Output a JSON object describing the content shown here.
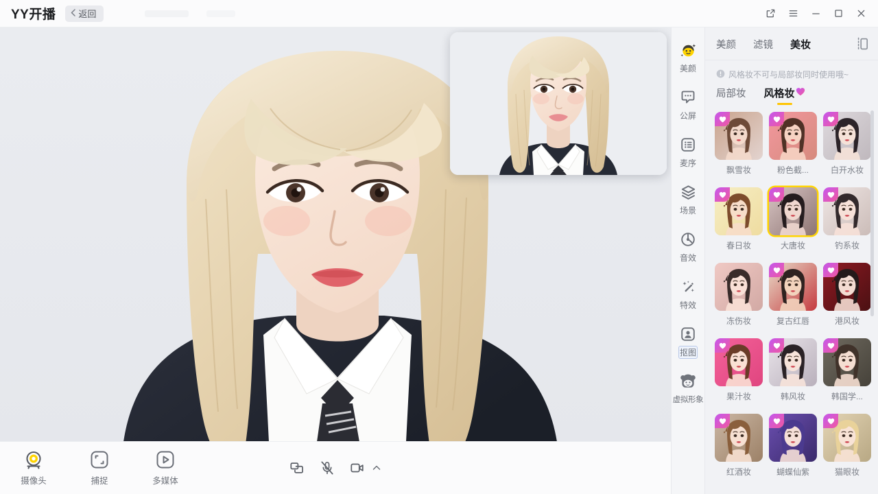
{
  "titlebar": {
    "brand": "YY开播",
    "back_label": "返回",
    "back_icon": "chevron-left-icon",
    "window_controls": [
      {
        "name": "external-link-icon",
        "label": "弹出"
      },
      {
        "name": "menu-icon",
        "label": "菜单"
      },
      {
        "name": "minimize-icon",
        "label": "最小化"
      },
      {
        "name": "maximize-icon",
        "label": "最大化"
      },
      {
        "name": "close-icon",
        "label": "关闭"
      }
    ]
  },
  "stage": {
    "canvas_bg": "#e8eaee",
    "pip": {
      "name": "preview-window",
      "visible": true
    }
  },
  "bottombar": {
    "tools": [
      {
        "icon": "webcam-icon",
        "label": "摄像头",
        "active": true
      },
      {
        "icon": "capture-icon",
        "label": "捕捉",
        "active": false
      },
      {
        "icon": "multimedia-icon",
        "label": "多媒体",
        "active": false
      }
    ],
    "mid_controls": [
      {
        "icon": "screen-share-icon",
        "label": "共享屏幕",
        "state": "on"
      },
      {
        "icon": "microphone-muted-icon",
        "label": "麦克风已静音",
        "state": "muted"
      },
      {
        "icon": "camera-icon",
        "label": "摄像头",
        "state": "on"
      },
      {
        "icon": "chevron-up-icon",
        "label": "更多设备",
        "state": "collapsed"
      }
    ]
  },
  "rail": {
    "items": [
      {
        "icon": "beauty-face-icon",
        "label": "美颜",
        "active": true
      },
      {
        "icon": "public-screen-icon",
        "label": "公屏",
        "active": false
      },
      {
        "icon": "mic-queue-icon",
        "label": "麦序",
        "active": false
      },
      {
        "icon": "scene-layers-icon",
        "label": "场景",
        "active": false
      },
      {
        "icon": "sound-effect-icon",
        "label": "音效",
        "active": false
      },
      {
        "icon": "special-effect-icon",
        "label": "特效",
        "active": false
      },
      {
        "icon": "cutout-icon",
        "label": "抠图",
        "active": false,
        "label_boxed": true
      },
      {
        "icon": "virtual-avatar-icon",
        "label": "虚拟形象",
        "active": false
      }
    ]
  },
  "panel": {
    "tabs": [
      {
        "label": "美颜",
        "active": false
      },
      {
        "label": "滤镜",
        "active": false
      },
      {
        "label": "美妆",
        "active": true
      }
    ],
    "collapse_icon": "collapse-panel-icon",
    "notice": "风格妆不可与局部妆同时使用哦~",
    "notice_icon": "warning-circle-icon",
    "subtabs": [
      {
        "label": "局部妆",
        "active": false,
        "badge": false
      },
      {
        "label": "风格妆",
        "active": true,
        "badge": true,
        "badge_icon": "heart-badge-icon"
      }
    ],
    "accent_color": "#ffc400",
    "selected_style": "大唐妆",
    "styles": [
      {
        "label": "飘雪妆",
        "selected": false,
        "favorite": true,
        "c1": "#c9a38c",
        "c2": "#e3d4d0",
        "hair": "#6d4a38",
        "skin": "#f3d9cb"
      },
      {
        "label": "粉色截...",
        "selected": false,
        "favorite": true,
        "c1": "#f3989f",
        "c2": "#d68a7d",
        "hair": "#4f3126",
        "skin": "#f6d3c3"
      },
      {
        "label": "白开水妆",
        "selected": false,
        "favorite": true,
        "c1": "#ded9dd",
        "c2": "#bfb8bd",
        "hair": "#2c2429",
        "skin": "#f5e2d8"
      },
      {
        "label": "春日妆",
        "selected": false,
        "favorite": true,
        "c1": "#f6eec4",
        "c2": "#efdca0",
        "hair": "#7d4c2c",
        "skin": "#f7ddc9"
      },
      {
        "label": "大唐妆",
        "selected": true,
        "favorite": true,
        "c1": "#d8c5c4",
        "c2": "#8d7472",
        "hair": "#251c1e",
        "skin": "#f0d7cf"
      },
      {
        "label": "钓系妆",
        "selected": false,
        "favorite": true,
        "c1": "#efe6e4",
        "c2": "#cbbcb8",
        "hair": "#332a2c",
        "skin": "#f7e1d8"
      },
      {
        "label": "冻伤妆",
        "selected": false,
        "favorite": false,
        "c1": "#f0c9c4",
        "c2": "#d2a9a4",
        "hair": "#3a2c2a",
        "skin": "#f9e0d6"
      },
      {
        "label": "复古红唇",
        "selected": false,
        "favorite": true,
        "c1": "#e8dcc9",
        "c2": "#c53a3f",
        "hair": "#2e2220",
        "skin": "#f2d3bd"
      },
      {
        "label": "港风妆",
        "selected": false,
        "favorite": true,
        "c1": "#8e1a22",
        "c2": "#4b1013",
        "hair": "#241a1a",
        "skin": "#f4dcd2"
      },
      {
        "label": "果汁妆",
        "selected": false,
        "favorite": true,
        "c1": "#f4629a",
        "c2": "#e0457f",
        "hair": "#6a3c28",
        "skin": "#fae0d4"
      },
      {
        "label": "韩风妆",
        "selected": false,
        "favorite": true,
        "c1": "#e9e4ea",
        "c2": "#b9b0bb",
        "hair": "#2a2226",
        "skin": "#f7e3da"
      },
      {
        "label": "韩国学...",
        "selected": false,
        "favorite": true,
        "c1": "#6f6a5f",
        "c2": "#46423a",
        "hair": "#40322a",
        "skin": "#f5ded2"
      },
      {
        "label": "红酒妆",
        "selected": false,
        "favorite": true,
        "c1": "#cbb7a4",
        "c2": "#9c8167",
        "hair": "#8a5f3c",
        "skin": "#f7e0d2"
      },
      {
        "label": "蝴蝶仙紫",
        "selected": false,
        "favorite": true,
        "c1": "#6b4fb0",
        "c2": "#3a2a6b",
        "hair": "#4b3a8f",
        "skin": "#f6e0d8"
      },
      {
        "label": "猫眼妆",
        "selected": false,
        "favorite": true,
        "c1": "#e3d4b4",
        "c2": "#b8a884",
        "hair": "#e9d29a",
        "skin": "#f8e3d6"
      }
    ]
  }
}
